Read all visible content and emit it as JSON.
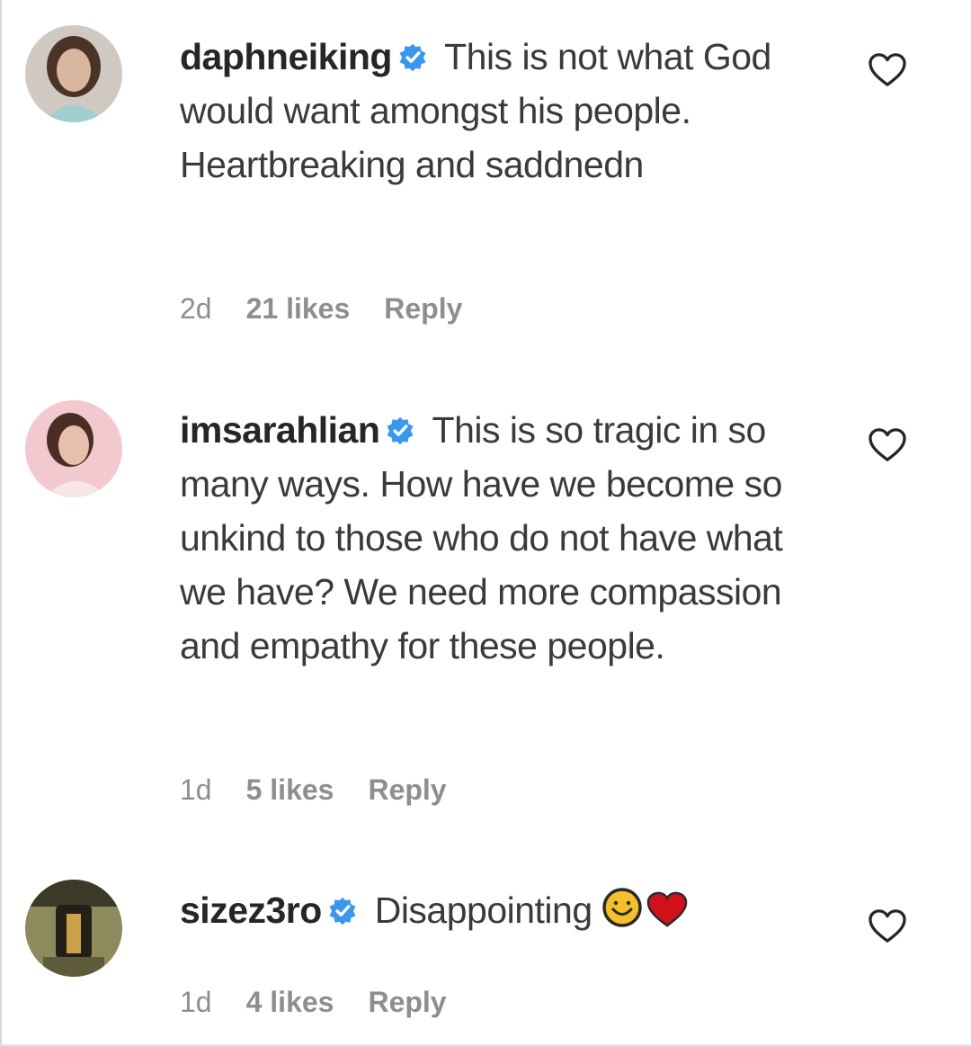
{
  "comments": [
    {
      "username": "daphneiking",
      "text": "This is not what God would want amongst his people. Heartbreaking and saddnedn",
      "time": "2d",
      "likes": "21 likes",
      "reply": "Reply"
    },
    {
      "username": "imsarahlian",
      "text": "This is so tragic in so many ways. How have we become so unkind to those who do not have what we have? We need more compassion and empathy for these people.",
      "time": "1d",
      "likes": "5 likes",
      "reply": "Reply"
    },
    {
      "username": "sizez3ro",
      "text": "Disappointing",
      "emojis": [
        "smiling-face-emoji",
        "red-heart-emoji"
      ],
      "time": "1d",
      "likes": "4 likes",
      "reply": "Reply"
    }
  ],
  "colors": {
    "verified_blue": "#3897f0",
    "meta_gray": "#8e8e8e",
    "heart_red": "#d0111b"
  },
  "icons": {
    "verified": "verified-badge-icon",
    "like": "heart-outline-icon"
  }
}
